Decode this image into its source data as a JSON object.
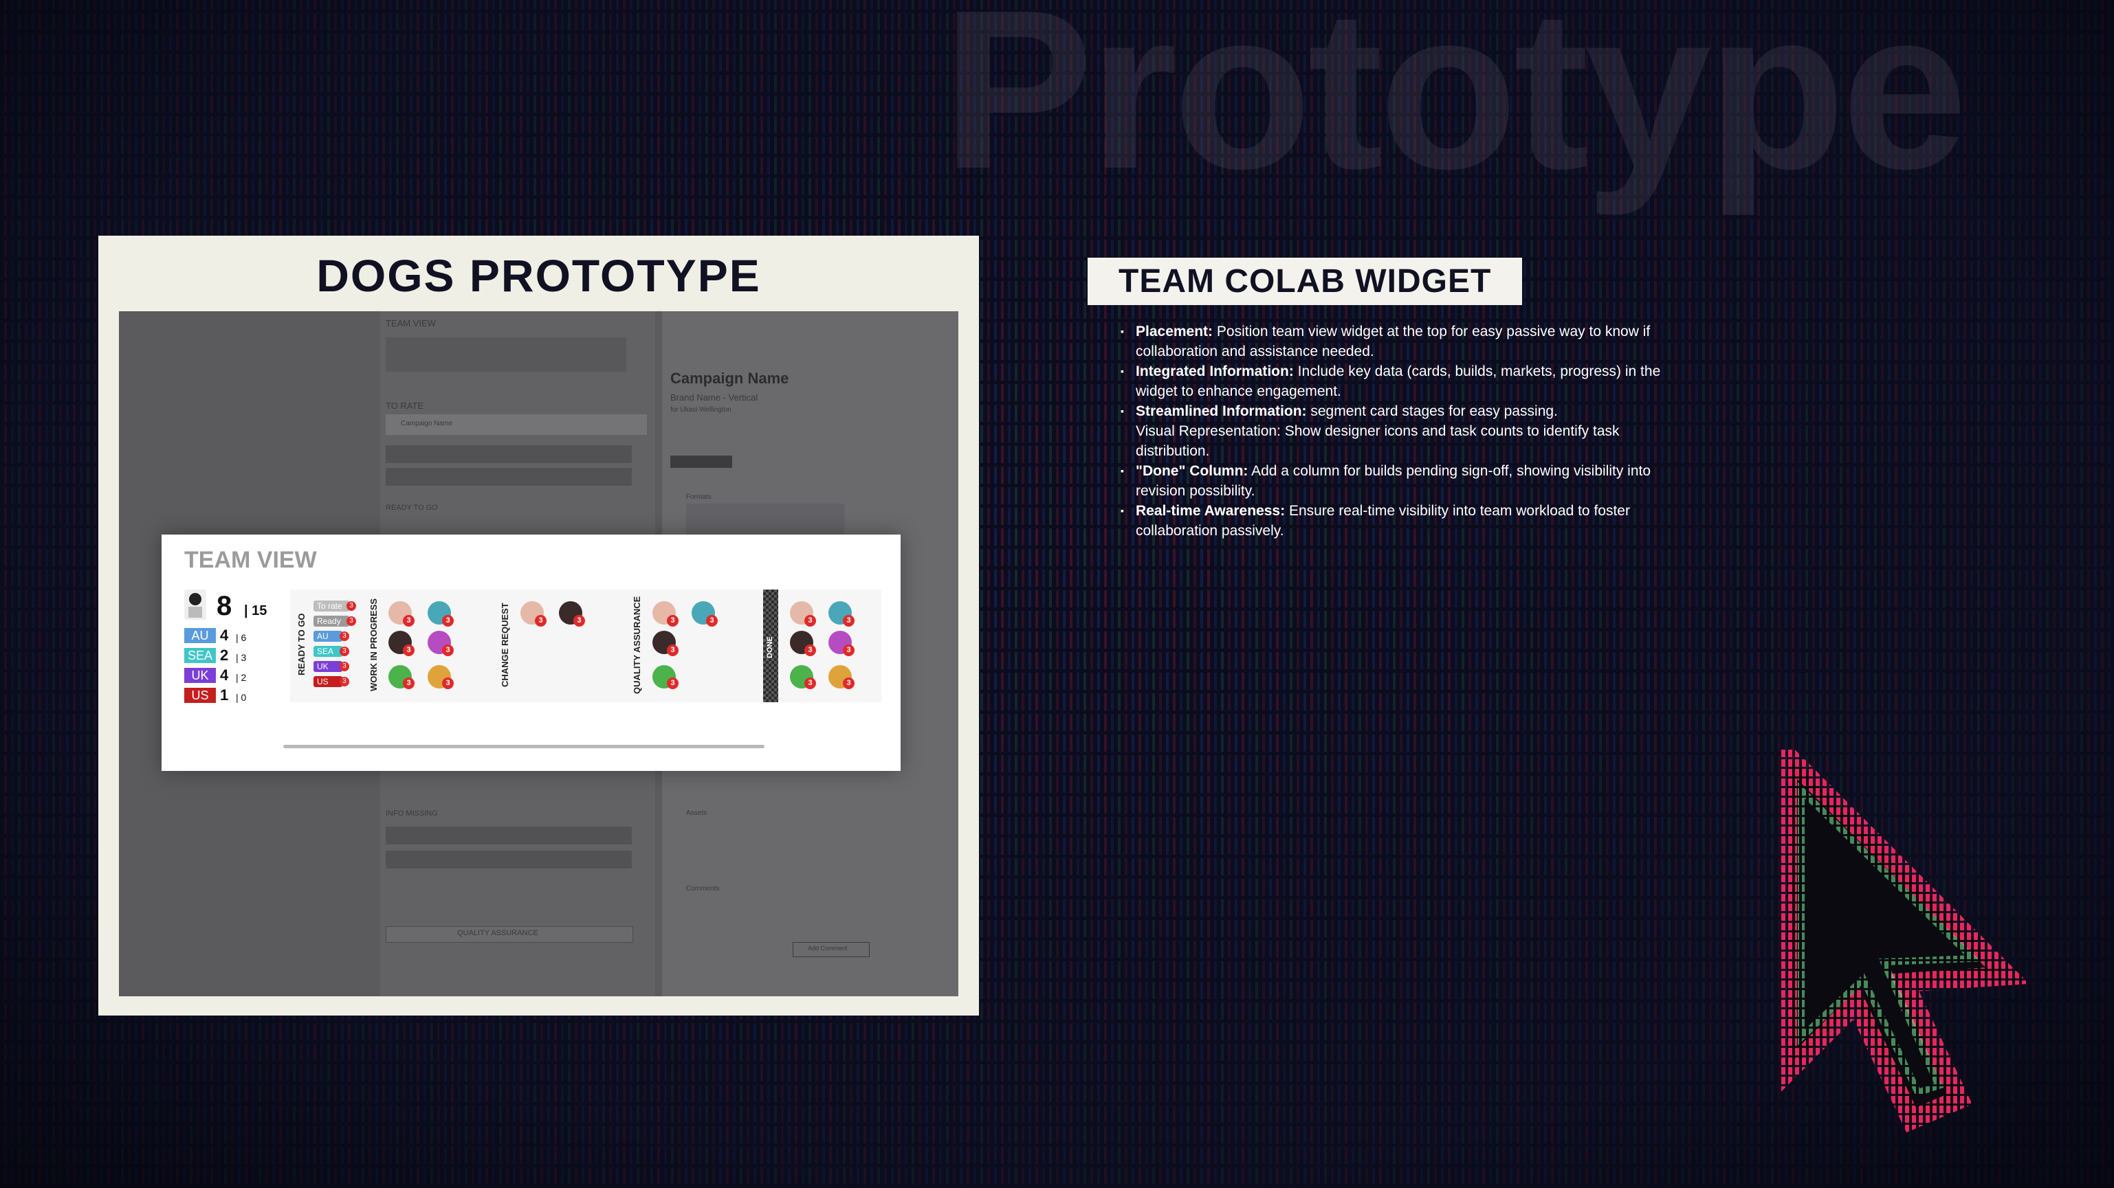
{
  "watermark": "Prototype",
  "prototype": {
    "title": "DOGS PROTOTYPE",
    "mock": {
      "team_view_label": "TEAM VIEW",
      "to_rate_label": "TO RATE",
      "campaign_row": "Campaign Name",
      "ready_label": "READY TO GO",
      "info_missing_label": "INFO MISSING",
      "qa_button": "QUALITY ASSURANCE",
      "campaign_title": "Campaign Name",
      "campaign_subtitle": "Brand Name - Vertical",
      "campaign_owner": "for Ukasi Wellington",
      "formats_label": "Formats",
      "assets_label": "Assets",
      "comments_label": "Comments",
      "add_comment": "Add Comment"
    }
  },
  "team_view": {
    "title": "TEAM VIEW",
    "total": "8",
    "total_sub": "| 15",
    "markets": [
      {
        "code": "AU",
        "count": "4",
        "sub": "| 6",
        "color": "#5b9bdc"
      },
      {
        "code": "SEA",
        "count": "2",
        "sub": "| 3",
        "color": "#3fc6c6"
      },
      {
        "code": "UK",
        "count": "4",
        "sub": "| 2",
        "color": "#7b3fd6"
      },
      {
        "code": "US",
        "count": "1",
        "sub": "| 0",
        "color": "#c41e1e"
      }
    ],
    "stages": [
      {
        "label": "To rate",
        "color": "#bdbdbd",
        "count": "3"
      },
      {
        "label": "Ready",
        "color": "#9a9a9a",
        "count": "3"
      },
      {
        "label": "AU",
        "color": "#5b9bdc",
        "count": "3"
      },
      {
        "label": "SEA",
        "color": "#3fc6c6",
        "count": "3"
      },
      {
        "label": "UK",
        "color": "#7b3fd6",
        "count": "3"
      },
      {
        "label": "US",
        "color": "#c41e1e",
        "count": "3"
      }
    ],
    "columns": {
      "ready": "READY TO GO",
      "wip": "WORK IN PROGRESS",
      "change": "CHANGE REQUEST",
      "qa": "QUALITY ASSURANCE",
      "done": "DONE"
    },
    "badge_value": "3"
  },
  "colab": {
    "title": "TEAM COLAB WIDGET",
    "bullets": [
      {
        "bold": "Placement:",
        "text": " Position team view widget at the top for easy passive way to know if collaboration and assistance needed."
      },
      {
        "bold": "Integrated Information:",
        "text": " Include key data (cards, builds, markets, progress) in the widget to enhance engagement."
      },
      {
        "bold": "Streamlined Information:",
        "text": " segment card stages for easy passing.",
        "extra": "Visual Representation: Show designer icons and task counts to identify task distribution."
      },
      {
        "bold": "\"Done\" Column:",
        "text": " Add a column for builds pending sign-off, showing visibility into revision possibility."
      },
      {
        "bold": "Real-time Awareness:",
        "text": " Ensure real-time visibility into team workload to foster collaboration passively."
      }
    ]
  }
}
